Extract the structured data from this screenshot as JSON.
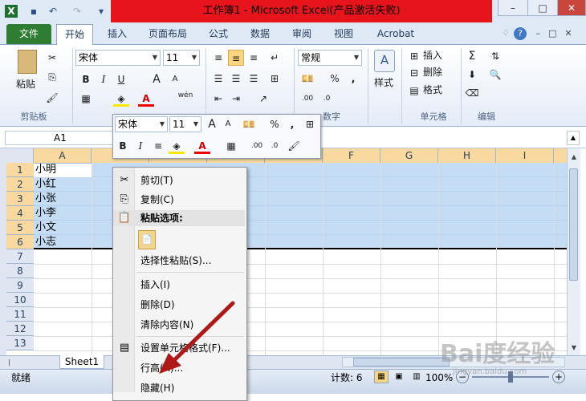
{
  "window": {
    "title": "工作簿1 - Microsoft Excel(产品激活失败)",
    "min": "–",
    "max": "□",
    "close": "✕"
  },
  "ribbon_tabs": [
    "文件",
    "开始",
    "插入",
    "页面布局",
    "公式",
    "数据",
    "审阅",
    "视图",
    "Acrobat"
  ],
  "ribbon": {
    "clipboard": {
      "group": "剪贴板",
      "paste": "粘贴"
    },
    "font": {
      "name": "宋体",
      "size": "11",
      "bold": "B",
      "italic": "I",
      "underline": "U",
      "grow": "A",
      "shrink": "A",
      "wen": "wén"
    },
    "number": {
      "format": "常规",
      "percent": "%",
      "comma": ",",
      "group": "数字"
    },
    "styles": {
      "label": "样式"
    },
    "cells": {
      "insert": "插入",
      "delete": "删除",
      "format": "格式",
      "group": "单元格"
    },
    "editing": {
      "sigma": "Σ",
      "group": "编辑"
    }
  },
  "formula_bar": {
    "name_box": "A1"
  },
  "grid": {
    "columns": [
      "A",
      "B",
      "C",
      "D",
      "E",
      "F",
      "G",
      "H",
      "I"
    ],
    "rows": [
      "1",
      "2",
      "3",
      "4",
      "5",
      "6",
      "7",
      "8",
      "9",
      "10",
      "11",
      "12",
      "13"
    ],
    "cells_col_a": [
      "小明",
      "小红",
      "小张",
      "小李",
      "小文",
      "小志"
    ]
  },
  "mini_toolbar": {
    "font": "宋体",
    "size": "11",
    "grow": "A",
    "shrink": "A",
    "percent": "%",
    "comma": ",",
    "bold": "B",
    "italic": "I",
    "align": "≡"
  },
  "context_menu": {
    "cut": "剪切(T)",
    "copy": "复制(C)",
    "paste_options": "粘贴选项:",
    "paste_special": "选择性粘贴(S)...",
    "insert": "插入(I)",
    "delete": "删除(D)",
    "clear": "清除内容(N)",
    "format_cells": "设置单元格格式(F)...",
    "row_height": "行高(R)...",
    "hide": "隐藏(H)"
  },
  "sheet_tab": "Sheet1",
  "status": {
    "ready": "就绪",
    "count": "计数: 6",
    "zoom": "100%",
    "minus": "−",
    "plus": "+"
  },
  "watermark": {
    "logo": "Bai度经验",
    "url": "jingyan.baidu.com"
  },
  "colors": {
    "title_red": "#e8141b",
    "file_tab": "#2f7d32",
    "selection": "#c5dcf5",
    "header_selected": "#f9d99f",
    "arrow": "#b01818"
  }
}
